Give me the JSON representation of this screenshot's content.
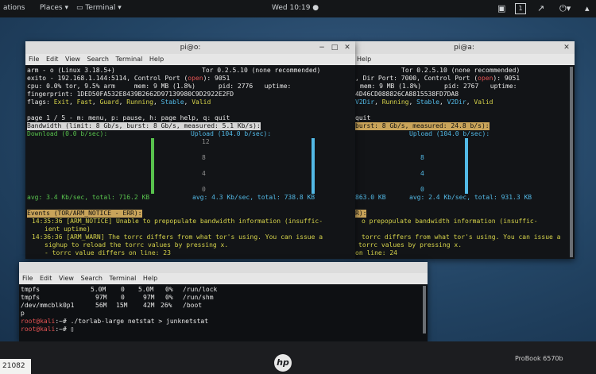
{
  "topbar": {
    "activities": "ations",
    "places": "Places",
    "terminal": "Terminal",
    "clock": "Wed 10:19",
    "workspace": "1"
  },
  "win1": {
    "title": "pi@o:",
    "menu": [
      "File",
      "Edit",
      "View",
      "Search",
      "Terminal",
      "Help"
    ],
    "header_tor": "Tor 0.2.5.10 (none recommended)",
    "l1": "arm - o (Linux 3.18.5+)",
    "l2": "exito - 192.168.1.144:5114, Control Port (",
    "l2_open": "open",
    "l2_end": "): 9051",
    "l3": "cpu: 0.0% tor, 9.5% arm     mem: 9 MB (1.8%)      pid: 2776   uptime:",
    "l4": "fingerprint: 1DED50FA532E8439B2662D97139980C9D2922E2FD",
    "flags_label": "flags:",
    "flags": [
      "Exit",
      "Fast",
      "Guard",
      "Running",
      "Stable",
      "Valid"
    ],
    "page": "page 1 / 5 - m: menu, p: pause, h: page help, q: quit",
    "bandwidth": "Bandwidth (limit: 8 Gb/s, burst: 8 Gb/s, measured: 5.1 Kb/s):",
    "download": "Download (0.0 b/sec):",
    "upload": "Upload (104.0 b/sec):",
    "y_ticks": [
      "12",
      "8",
      "4",
      "0"
    ],
    "down_avg": "avg: 3.4 Kb/sec, total: 716.2 KB",
    "up_avg": "avg: 4.3 Kb/sec, total: 738.8 KB",
    "events": "Events (TOR/ARM_NOTICE - ERR):",
    "ev1": "14:35:36 [ARM_NOTICE] Unable to prepopulate bandwidth information (insuffic-",
    "ev1b": "ient uptime)",
    "ev2": "14:36:36 [ARM_WARN] The torrc differs from what tor's using. You can issue a",
    "ev2b": "sighup to reload the torrc values by pressing x.",
    "ev2c": "- torrc value differs on line: 23"
  },
  "win2": {
    "title": "pi@a:",
    "menu": [
      "Help"
    ],
    "header_tor": "Tor 0.2.5.10 (none recommended)",
    "l2": "Dir Port: 7000, Control Port (",
    "l2_open": "open",
    "l2_end": "): 9051",
    "l3": "mem: 9 MB (1.8%)      pid: 2767   uptime:",
    "l4": "4D46CD088826CA8815538FD7DA8",
    "flags": [
      "V2Dir",
      "Running",
      "Stable",
      "V2Dir",
      "Valid"
    ],
    "page": "quit",
    "bandwidth": "burst: 8 Gb/s, measured: 24.8 b/s):",
    "upload": "Upload (104.0 b/sec):",
    "y_ticks": [
      "8",
      "4",
      "0"
    ],
    "down_avg": "863.0 KB",
    "up_avg": "avg: 2.4 Kb/sec, total: 931.3 KB",
    "events": "R):",
    "ev1": "o prepopulate bandwidth information (insuffic-",
    "ev2": "torrc differs from what tor's using. You can issue a",
    "ev2b": "torrc values by pressing x.",
    "ev2c": "on line: 24"
  },
  "win3": {
    "menu": [
      "File",
      "Edit",
      "View",
      "Search",
      "Terminal",
      "Help"
    ],
    "df_rows": [
      [
        "tmpfs",
        "5.0M",
        "0",
        "5.0M",
        "0%",
        "/run/lock"
      ],
      [
        "tmpfs",
        "97M",
        "0",
        "97M",
        "0%",
        "/run/shm"
      ],
      [
        "/dev/mmcblk0p1",
        "56M",
        "15M",
        "42M",
        "26%",
        "/boot"
      ]
    ],
    "p_line": "p",
    "prompt": "root@kali",
    "path": ":~#",
    "cmd": " ./torlab-large netstat > junknetstat"
  },
  "bezel": {
    "brand": "hp",
    "model": "ProBook 6570b",
    "sticker": "21082"
  },
  "colors": {
    "exit": "#d5d24a",
    "fast": "#d5d24a",
    "guard": "#d5d24a",
    "running": "#d5d24a",
    "stable": "#52b9e6",
    "valid": "#d5d24a",
    "download": "#58c24d",
    "upload": "#52b9e6",
    "prompt": "#e35252"
  }
}
